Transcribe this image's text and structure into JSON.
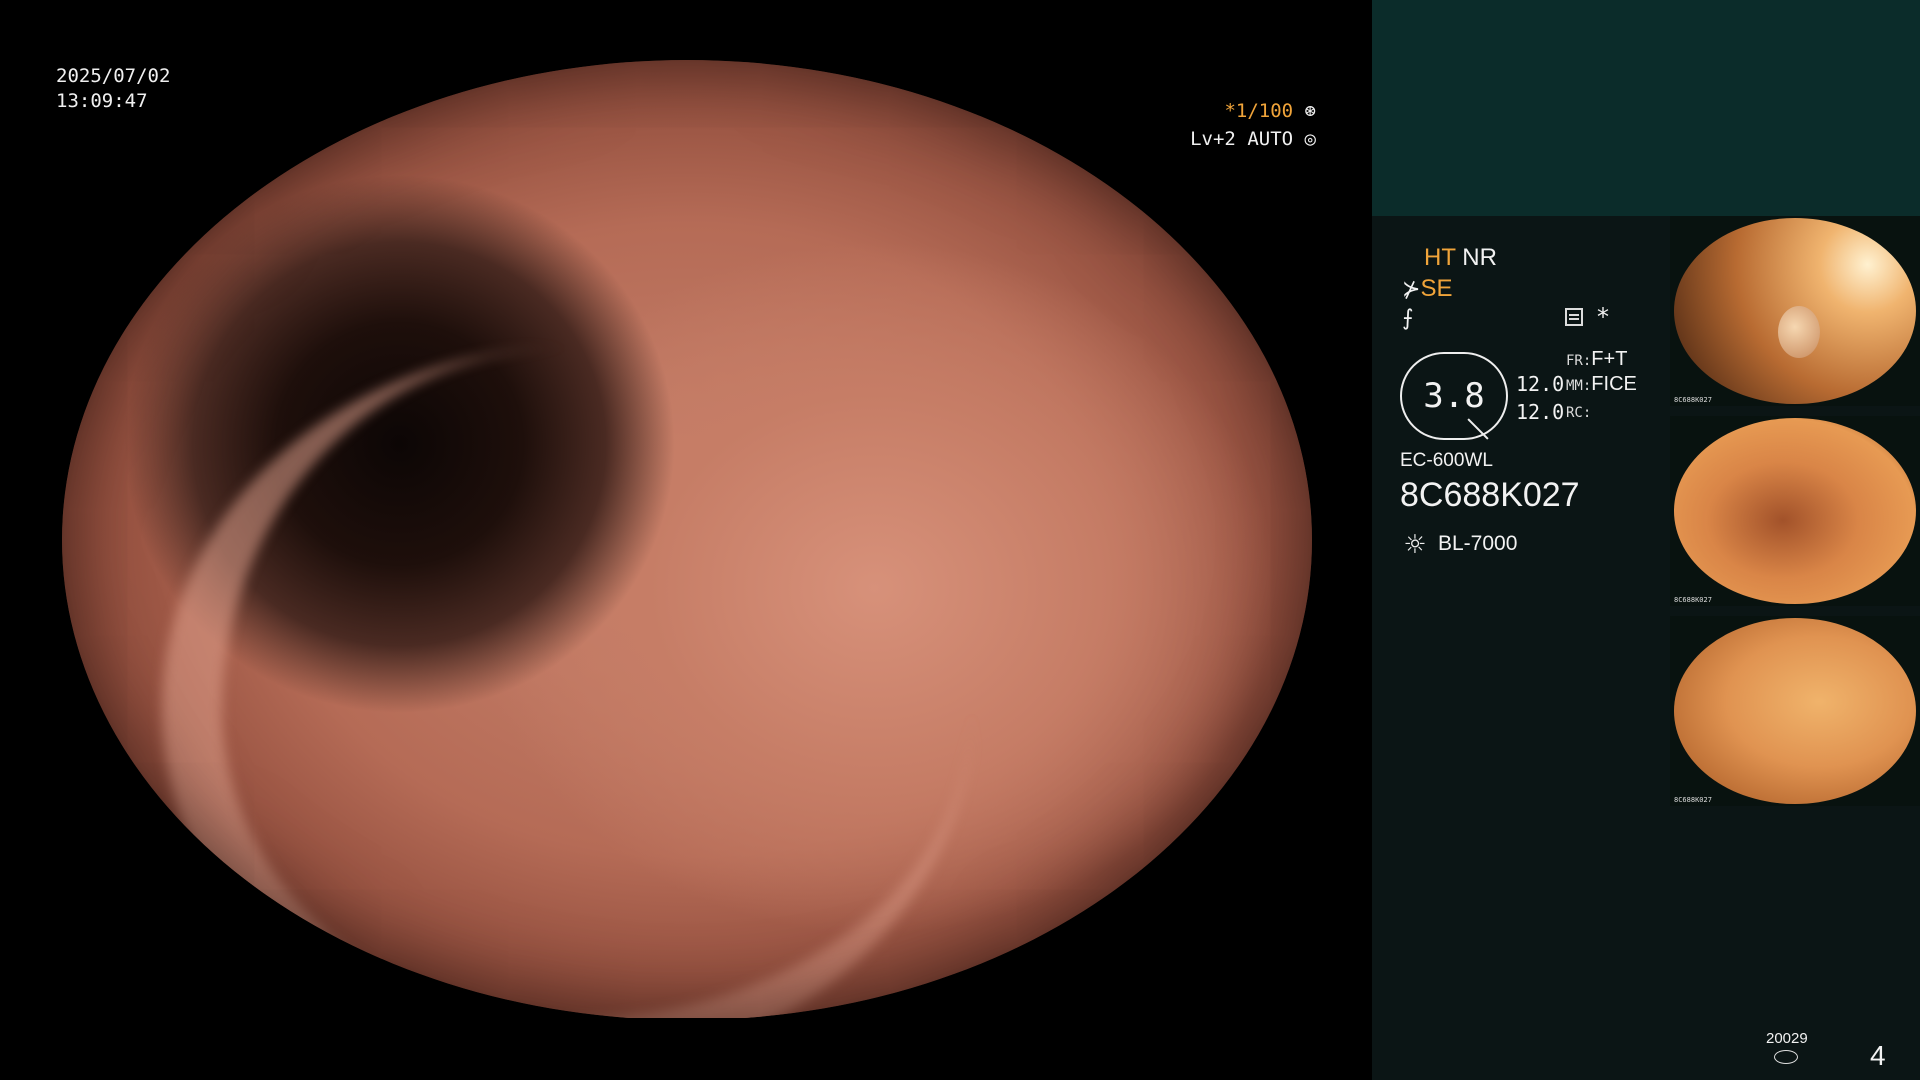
{
  "overlay": {
    "date": "2025/07/02",
    "time": "13:09:47",
    "shutter": "*1/100",
    "iris_prefix": "Lv+2",
    "iris_mode": "AUTO"
  },
  "panel": {
    "ht_label": "HT",
    "nr_label": "NR",
    "se_label": "SE",
    "zoom_value": "3.8",
    "value_1": "12.0",
    "value_2": "12.0",
    "fr_key": "FR:",
    "fr_value": "F+T",
    "mm_key": "MM:",
    "mm_value": "FICE",
    "rc_key": "RC:",
    "rc_value": "",
    "star_mark": "*",
    "scope_model": "EC-600WL",
    "scope_serial": "8C688K027",
    "light_source": "BL-7000",
    "frame_code": "20029",
    "page_number": "4"
  },
  "thumbnails": [
    {
      "label": "8C688K027"
    },
    {
      "label": "8C688K027"
    },
    {
      "label": "8C688K027"
    }
  ],
  "colors": {
    "accent_orange": "#f0a43a",
    "panel_top": "#0b2c2a",
    "panel_main": "#0b1515"
  },
  "icons": {
    "shutter": "aperture-icon",
    "iris": "iris-icon",
    "se": "structure-icon",
    "filter": "filter-icon",
    "grid": "settings-grid-icon",
    "light": "light-bulb-icon",
    "db": "storage-icon"
  }
}
